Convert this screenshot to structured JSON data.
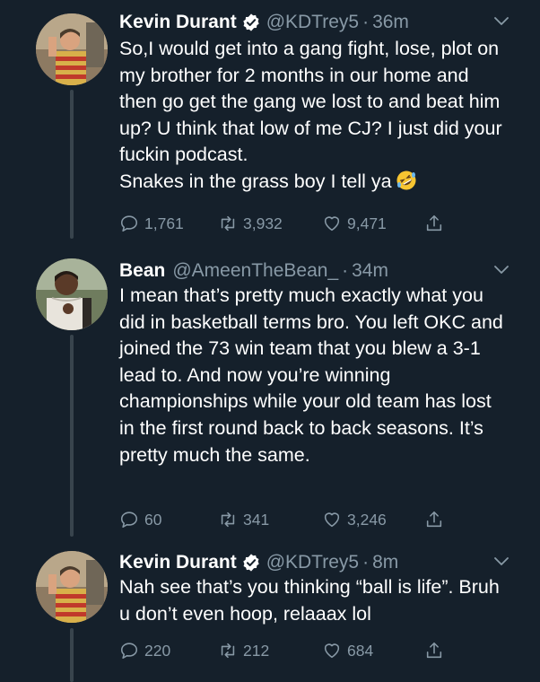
{
  "tweets": [
    {
      "name": "Kevin Durant",
      "verified": true,
      "handle": "@KDTrey5",
      "dot": "·",
      "time": "36m",
      "text": "So,I would get into a gang fight, lose, plot on my brother for 2 months in our home and then go get the gang we lost to and beat him up? U think that low of me CJ? I just did your fuckin podcast.\nSnakes in the grass boy I tell ya",
      "emoji": "rolling-on-floor-laughing-emoji",
      "replies": "1,761",
      "retweets": "3,932",
      "likes": "9,471"
    },
    {
      "name": "Bean",
      "verified": false,
      "handle": "@AmeenTheBean_",
      "dot": "·",
      "time": "34m",
      "text": "I mean that’s pretty much exactly what you did in basketball terms bro. You left OKC and joined the 73 win team that you blew a 3-1 lead to. And now you’re winning championships while your old team has lost in the first round back to back seasons. It’s pretty much the same.",
      "replies": "60",
      "retweets": "341",
      "likes": "3,246"
    },
    {
      "name": "Kevin Durant",
      "verified": true,
      "handle": "@KDTrey5",
      "dot": "·",
      "time": "8m",
      "text": "Nah see that’s you thinking “ball is life”. Bruh u don’t even hoop, relaaax lol",
      "replies": "220",
      "retweets": "212",
      "likes": "684"
    }
  ],
  "colors": {
    "background": "#15202b",
    "text": "#ffffff",
    "muted": "#8899a6",
    "thread_line": "#38444d",
    "verified": "#ffffff"
  }
}
